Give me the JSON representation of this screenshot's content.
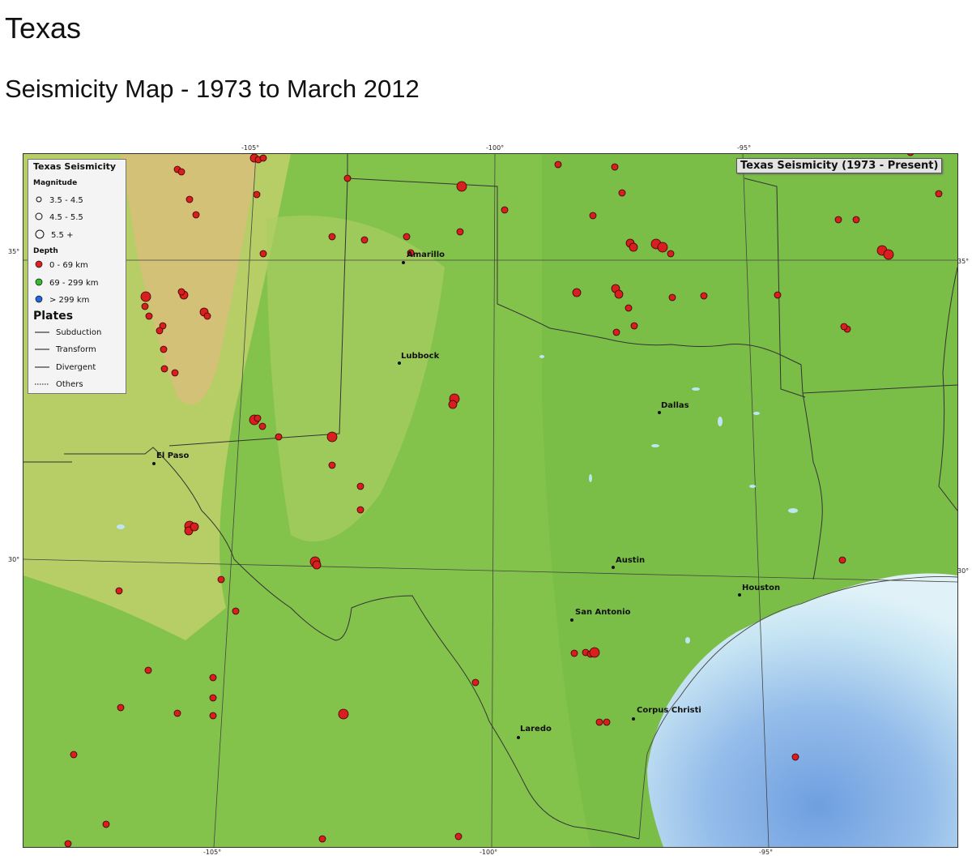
{
  "page": {
    "title": "Texas",
    "subtitle": "Seismicity Map - 1973 to March 2012"
  },
  "map": {
    "badge": "Texas Seismicity (1973 - Present)",
    "longitude_ticks_top": [
      "-105°",
      "-100°",
      "-95°"
    ],
    "longitude_ticks_bottom": [
      "-105°",
      "-100°",
      "-95°"
    ],
    "latitude_ticks_left": [
      "35°",
      "30°"
    ],
    "latitude_ticks_right": [
      "35°",
      "30°"
    ],
    "cities": [
      "Amarillo",
      "Lubbock",
      "Dallas",
      "El Paso",
      "Austin",
      "Houston",
      "San Antonio",
      "Corpus Christi",
      "Laredo"
    ],
    "colors": {
      "land_green": "#7ec24a",
      "land_tan": "#cbc97a",
      "water": "#bfe4f2",
      "deep_water": "#8fb8e8",
      "quake": "#d81e1e"
    },
    "earthquake_count": 92
  },
  "legend": {
    "title": "Texas Seismicity",
    "magnitude_heading": "Magnitude",
    "magnitude_items": [
      "3.5 - 4.5",
      "4.5 - 5.5",
      "5.5 +"
    ],
    "depth_heading": "Depth",
    "depth_items": [
      {
        "label": "0 - 69 km",
        "color": "#e02020"
      },
      {
        "label": "69 - 299 km",
        "color": "#2fbf2f"
      },
      {
        "label": "> 299  km",
        "color": "#2266dd"
      }
    ],
    "plates_heading": "Plates",
    "plate_items": [
      "Subduction",
      "Transform",
      "Divergent",
      "Others"
    ]
  }
}
